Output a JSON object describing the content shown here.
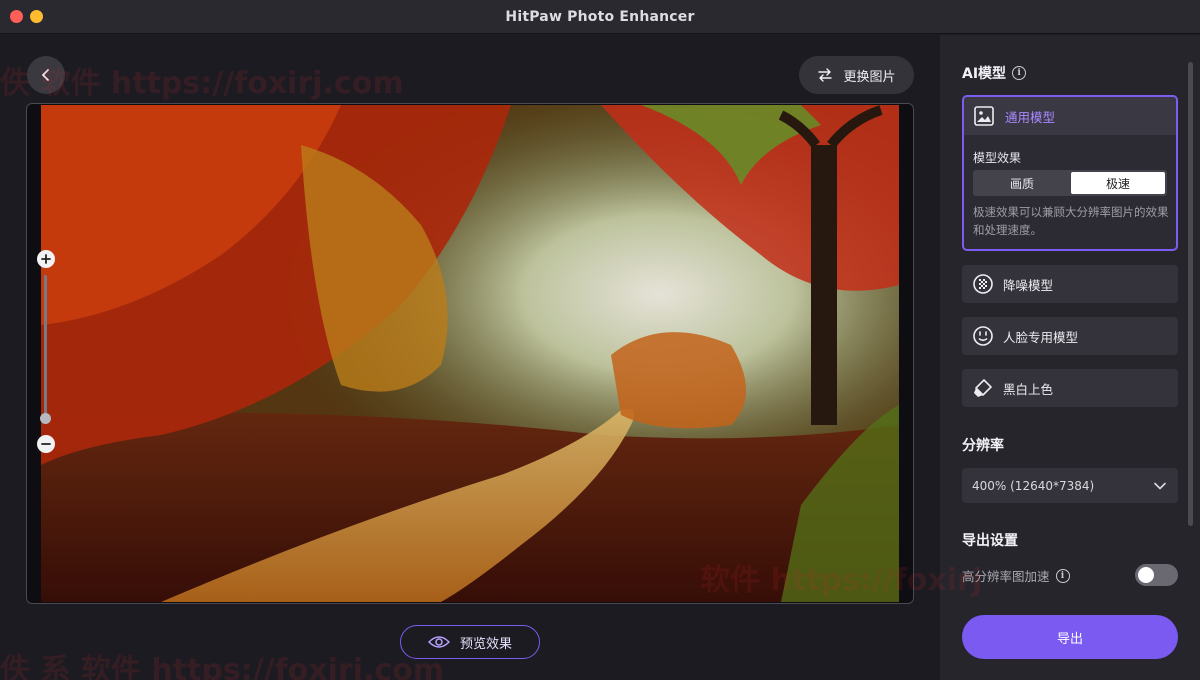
{
  "window": {
    "title": "HitPaw Photo Enhancer"
  },
  "workspace": {
    "replace_label": "更换图片",
    "preview_label": "预览效果"
  },
  "panel": {
    "ai_model_title": "AI模型",
    "active_model": {
      "label": "通用模型",
      "effect_label": "模型效果",
      "options": [
        "画质",
        "极速"
      ],
      "selected_option": "极速",
      "description": "极速效果可以兼顾大分辨率图片的效果和处理速度。"
    },
    "models": [
      {
        "label": "降噪模型",
        "icon": "denoise-icon"
      },
      {
        "label": "人脸专用模型",
        "icon": "face-icon"
      },
      {
        "label": "黑白上色",
        "icon": "colorize-icon"
      }
    ],
    "resolution_title": "分辨率",
    "resolution_value": "400% (12640*7384)",
    "export_settings_title": "导出设置",
    "hires_accel_label": "高分辨率图加速",
    "hires_accel_on": false,
    "export_label": "导出"
  },
  "watermarks": [
    "佚 软件 https://foxirj.com",
    "软件 https://foxirj",
    "佚 系 软件 https://foxirj.com"
  ],
  "colors": {
    "accent": "#7a5af0",
    "panel_bg": "#26252c",
    "canvas_bg": "#1c1b22"
  }
}
